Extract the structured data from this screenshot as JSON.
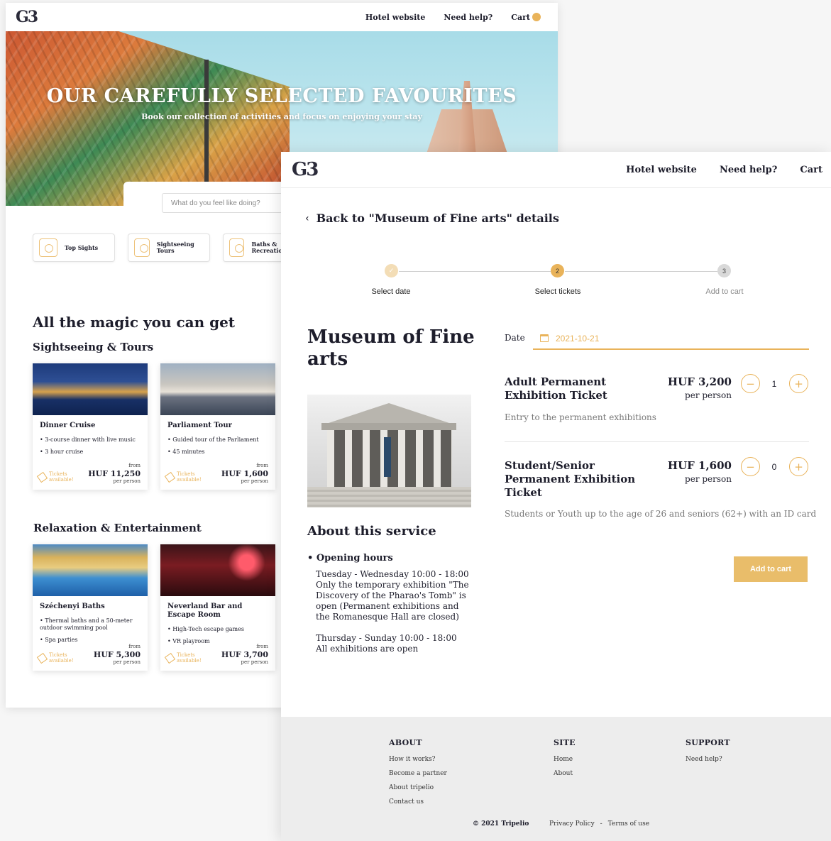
{
  "back_window": {
    "logo": "G3",
    "nav": {
      "hotel": "Hotel website",
      "help": "Need help?",
      "cart": "Cart"
    },
    "hero": {
      "title": "OUR CAREFULLY SELECTED FAVOURITES",
      "subtitle": "Book our collection of activities and focus on enjoying your stay"
    },
    "search": {
      "placeholder": "What do you feel like doing?"
    },
    "categories": [
      {
        "label": "Top Sights",
        "icon": "camera-icon"
      },
      {
        "label": "Sightseeing Tours",
        "icon": "signpost-icon"
      },
      {
        "label": "Baths & Recreatio",
        "icon": "umbrella-icon"
      }
    ],
    "heading_magic": "All the magic you can get",
    "heading_sight": "Sightseeing & Tours",
    "heading_relax": "Relaxation & Entertainment",
    "cards": [
      {
        "title": "Dinner Cruise",
        "bullets": [
          "3-course dinner with live music",
          "3 hour cruise"
        ],
        "tickets": "Tickets available!",
        "from": "from",
        "price": "HUF 11,250",
        "per": "per person"
      },
      {
        "title": "Parliament Tour",
        "bullets": [
          "Guided tour of the Parliament",
          "45 minutes"
        ],
        "tickets": "Tickets available!",
        "from": "from",
        "price": "HUF 1,600",
        "per": "per person"
      },
      {
        "title": "Széchenyi Baths",
        "bullets": [
          "Thermal baths and a 50-meter outdoor swimming pool",
          "Spa parties"
        ],
        "tickets": "Tickets available!",
        "from": "from",
        "price": "HUF 5,300",
        "per": "per person"
      },
      {
        "title": "Neverland Bar and Escape Room",
        "bullets": [
          "High-Tech escape games",
          "VR playroom"
        ],
        "tickets": "Tickets available!",
        "from": "from",
        "price": "HUF 3,700",
        "per": "per person"
      }
    ]
  },
  "front_window": {
    "logo": "G3",
    "nav": {
      "hotel": "Hotel website",
      "help": "Need help?",
      "cart": "Cart"
    },
    "back_link": "Back to \"Museum of Fine arts\" details",
    "steps": [
      {
        "num": "✓",
        "label": "Select date",
        "state": "done"
      },
      {
        "num": "2",
        "label": "Select tickets",
        "state": "active"
      },
      {
        "num": "3",
        "label": "Add to cart",
        "state": "todo"
      }
    ],
    "title": "Museum of Fine arts",
    "about_heading": "About this service",
    "hours_label": "Opening hours",
    "hours": [
      "Tuesday - Wednesday 10:00 - 18:00",
      "Only the temporary exhibition \"The Discovery of the Pharao's Tomb\" is open (Permanent exhibitions and the Romanesque Hall are closed)",
      "Thursday - Sunday 10:00 - 18:00",
      "All exhibitions are open"
    ],
    "date_label": "Date",
    "date_value": "2021-10-21",
    "tickets": [
      {
        "name": "Adult Permanent Exhibition Ticket",
        "price": "HUF 3,200",
        "per": "per person",
        "qty": "1",
        "desc": "Entry to the permanent exhibitions"
      },
      {
        "name": "Student/Senior Permanent Exhibition Ticket",
        "price": "HUF 1,600",
        "per": "per person",
        "qty": "0",
        "desc": "Students or Youth up to the age of 26 and seniors (62+) with an ID card"
      }
    ],
    "add_to_cart": "Add to cart",
    "footer": {
      "about": {
        "head": "ABOUT",
        "links": [
          "How it works?",
          "Become a partner",
          "About tripelio",
          "Contact us"
        ]
      },
      "site": {
        "head": "SITE",
        "links": [
          "Home",
          "About"
        ]
      },
      "support": {
        "head": "SUPPORT",
        "links": [
          "Need help?"
        ]
      },
      "copyright": "© 2021 Tripelio",
      "privacy": "Privacy Policy",
      "sep": "-",
      "terms": "Terms of use"
    }
  },
  "colors": {
    "accent": "#e9b35a",
    "text": "#1d1d2b",
    "footer_bg": "#ededed"
  }
}
